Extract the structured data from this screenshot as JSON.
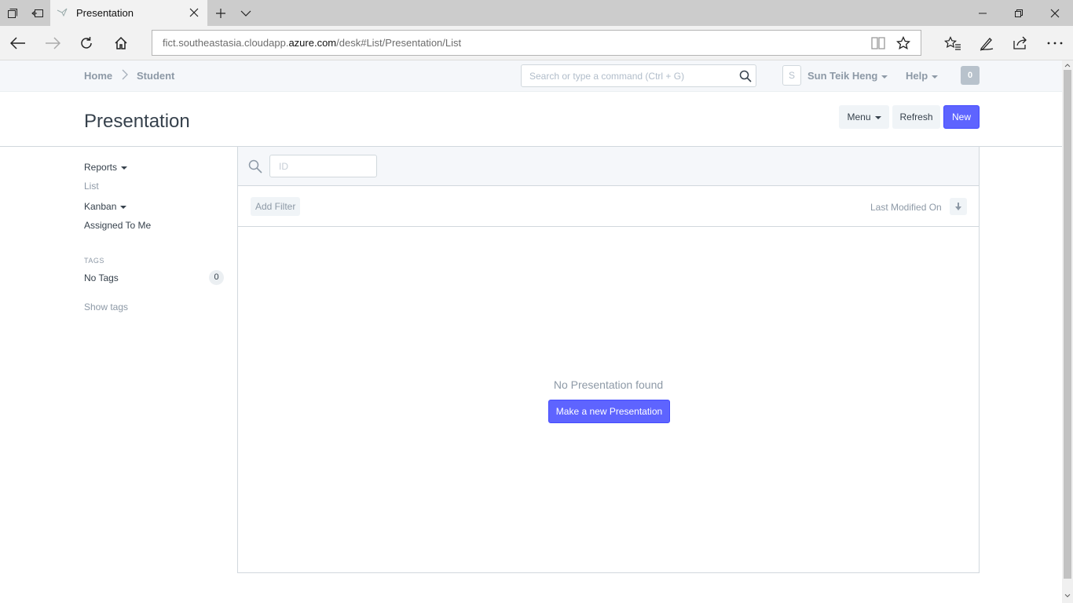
{
  "browser": {
    "tab_title": "Presentation",
    "url_prefix": "fict.southeastasia.cloudapp.",
    "url_host": "azure.com",
    "url_path": "/desk#List/Presentation/List"
  },
  "navbar": {
    "breadcrumb_home": "Home",
    "breadcrumb_current": "Student",
    "search_placeholder": "Search or type a command (Ctrl + G)",
    "avatar_initial": "S",
    "user_name": "Sun Teik Heng",
    "help_label": "Help",
    "notification_count": "0"
  },
  "page": {
    "title": "Presentation",
    "menu_label": "Menu",
    "refresh_label": "Refresh",
    "new_label": "New"
  },
  "sidebar": {
    "reports_label": "Reports",
    "list_label": "List",
    "kanban_label": "Kanban",
    "assigned_label": "Assigned To Me",
    "tags_heading": "TAGS",
    "no_tags_label": "No Tags",
    "no_tags_count": "0",
    "show_tags_label": "Show tags"
  },
  "list": {
    "id_placeholder": "ID",
    "add_filter_label": "Add Filter",
    "sort_label": "Last Modified On",
    "empty_message": "No Presentation found",
    "make_new_label": "Make a new Presentation"
  },
  "colors": {
    "primary": "#5e64ff",
    "muted_text": "#8d99a6",
    "text": "#36414c"
  }
}
